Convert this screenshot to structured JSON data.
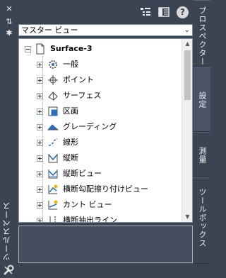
{
  "palette": {
    "title": "ツールスペース",
    "strip_close": "✕",
    "strip_pin": "⇅",
    "strip_props": "✱"
  },
  "toolbar": {
    "help": "?"
  },
  "view_select": {
    "value": "マスター ビュー"
  },
  "tree": {
    "root": "Surface-3",
    "items": [
      {
        "label": "一般",
        "icon": "gear-icon"
      },
      {
        "label": "ポイント",
        "icon": "point-icon"
      },
      {
        "label": "サーフェス",
        "icon": "surface-icon"
      },
      {
        "label": "区画",
        "icon": "parcel-icon"
      },
      {
        "label": "グレーディング",
        "icon": "grading-icon"
      },
      {
        "label": "線形",
        "icon": "alignment-icon"
      },
      {
        "label": "縦断",
        "icon": "profile-icon"
      },
      {
        "label": "縦断ビュー",
        "icon": "profile-view-icon"
      },
      {
        "label": "横断勾配擦り付けビュー",
        "icon": "superelevation-view-icon"
      },
      {
        "label": "カント ビュー",
        "icon": "cant-view-icon"
      },
      {
        "label": "横断抽出ライン",
        "icon": "sample-line-icon"
      }
    ]
  },
  "right_tabs": [
    {
      "label": "プロスペクター",
      "active": false
    },
    {
      "label": "設定",
      "active": true
    },
    {
      "label": "測量",
      "active": false
    },
    {
      "label": "ツールボックス",
      "active": false
    }
  ],
  "colors": {
    "panel_bg": "#3b4453",
    "tree_bg": "#ffffff",
    "accent": "#2e6fbd"
  }
}
